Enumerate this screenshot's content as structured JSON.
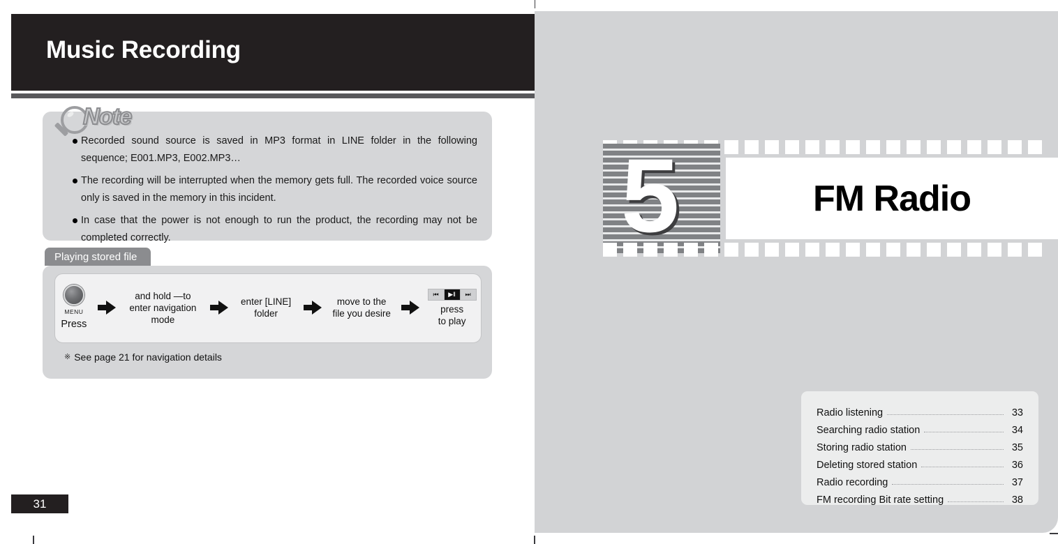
{
  "document": {
    "left_page": {
      "header_title": "Music Recording",
      "page_number": "31",
      "note": {
        "logo_text": "Note",
        "items": [
          "Recorded sound source is saved in MP3 format in LINE folder in the following sequence; E001.MP3, E002.MP3…",
          "The recording will be interrupted when the memory gets full. The recorded voice source only is saved in the memory in this incident.",
          "In case that the power is not enough to run the product, the recording may not be completed correctly."
        ]
      },
      "section": {
        "tab_label": "Playing stored file",
        "steps": [
          {
            "button_label": "MENU",
            "caption": "Press"
          },
          {
            "line1": "and hold —to",
            "line2": "enter navigation",
            "line3": "mode"
          },
          {
            "line1": "enter [LINE]",
            "line2": "folder"
          },
          {
            "line1": "move to the",
            "line2": "file you desire"
          },
          {
            "controls": [
              "⏮",
              "▶‖",
              "⏭"
            ],
            "line1": "press",
            "line2": "to play"
          }
        ],
        "footnote_mark": "※",
        "footnote": "See page 21 for navigation details"
      }
    },
    "right_page": {
      "chapter_number": "5",
      "chapter_title": "FM Radio",
      "toc": [
        {
          "label": "Radio listening",
          "page": "33"
        },
        {
          "label": "Searching radio station",
          "page": "34"
        },
        {
          "label": "Storing radio station",
          "page": "35"
        },
        {
          "label": "Deleting stored station",
          "page": "36"
        },
        {
          "label": "Radio recording",
          "page": "37"
        },
        {
          "label": "FM recording Bit rate setting",
          "page": "38"
        }
      ]
    }
  },
  "colors": {
    "header_dark": "#231f20",
    "rule_gray": "#58585b",
    "panel_gray": "#d5d6d8",
    "page_gray": "#d2d3d5",
    "tab_gray": "#8b8c8f",
    "stripe_gray": "#808285"
  }
}
